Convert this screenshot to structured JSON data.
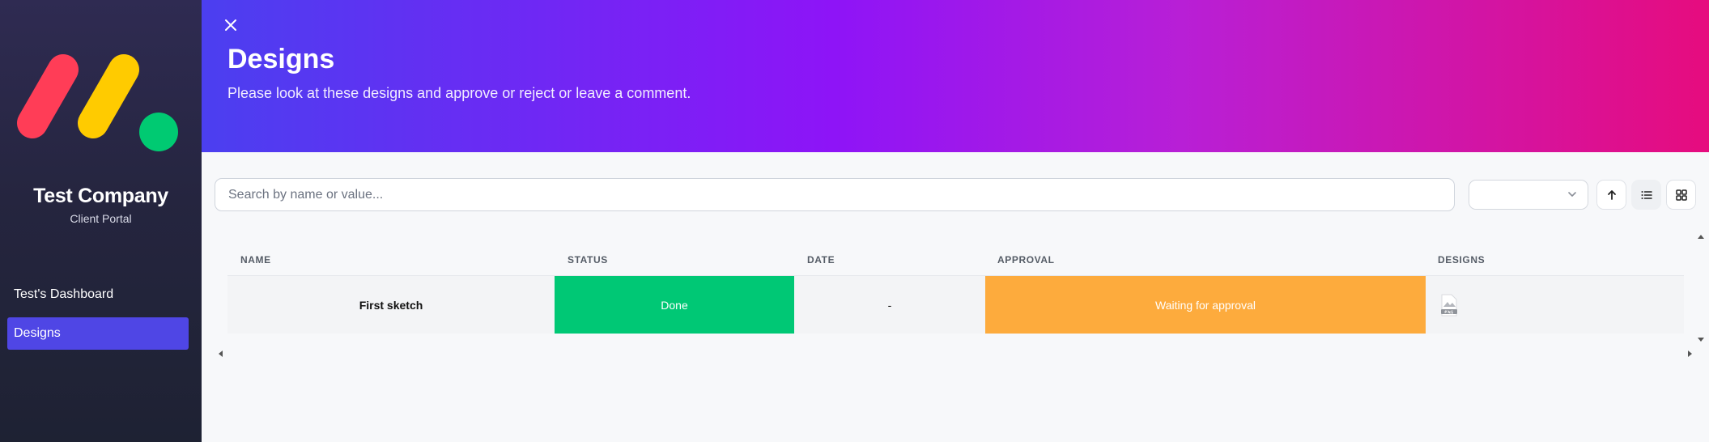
{
  "sidebar": {
    "company_name": "Test Company",
    "company_subtitle": "Client Portal",
    "items": [
      {
        "label": "Test's Dashboard",
        "active": false
      },
      {
        "label": "Designs",
        "active": true
      }
    ],
    "logo_colors": [
      "#ff3d57",
      "#ffcb00",
      "#00ca72"
    ]
  },
  "header": {
    "title": "Designs",
    "subtitle": "Please look at these designs and approve or reject or leave a comment.",
    "close_icon": "close-icon"
  },
  "toolbar": {
    "search_placeholder": "Search by name or value...",
    "sort_select_value": "",
    "icons": [
      "chevron-down-icon",
      "arrow-up-icon",
      "list-view-icon",
      "grid-view-icon"
    ]
  },
  "table": {
    "columns": [
      "NAME",
      "STATUS",
      "DATE",
      "APPROVAL",
      "DESIGNS"
    ],
    "rows": [
      {
        "name": "First sketch",
        "status": "Done",
        "date": "-",
        "approval": "Waiting for approval",
        "designs_icon": "png-file-icon"
      }
    ]
  },
  "colors": {
    "status_done": "#00c875",
    "approval_waiting": "#fdab3d",
    "nav_active": "#4f46e5"
  }
}
